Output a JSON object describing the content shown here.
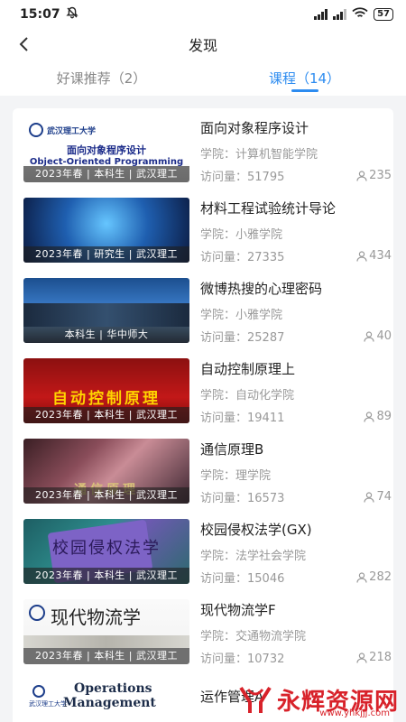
{
  "status": {
    "time": "15:07",
    "net_speed": "5.00\nK/s",
    "battery": "57"
  },
  "nav": {
    "title": "发现"
  },
  "tabs": [
    {
      "label": "好课推荐（2）",
      "active": false
    },
    {
      "label": "课程（14）",
      "active": true
    }
  ],
  "courses": [
    {
      "title": "面向对象程序设计",
      "school": "学院：计算机智能学院",
      "visits": "访问量：51795",
      "learners": "235",
      "caption": "2023年春 | 本科生 | 武汉理工",
      "thumb_title": "面向对象程序设计",
      "thumb_sub": "Object-Oriented Programming",
      "thumb_logo": "武汉理工大学"
    },
    {
      "title": "材料工程试验统计导论",
      "school": "学院：小雅学院",
      "visits": "访问量：27335",
      "learners": "434",
      "caption": "2023年春 | 研究生 | 武汉理工"
    },
    {
      "title": "微博热搜的心理密码",
      "school": "学院：小雅学院",
      "visits": "访问量：25287",
      "learners": "40",
      "caption": "本科生 | 华中师大"
    },
    {
      "title": "自动控制原理上",
      "school": "学院：自动化学院",
      "visits": "访问量：19411",
      "learners": "89",
      "caption": "2023年春 | 本科生 | 武汉理工",
      "thumb_title": "自动控制原理"
    },
    {
      "title": "通信原理B",
      "school": "学院：理学院",
      "visits": "访问量：16573",
      "learners": "74",
      "caption": "2023年春 | 本科生 | 武汉理工",
      "thumb_title": "通信原理"
    },
    {
      "title": "校园侵权法学(GX)",
      "school": "学院：法学社会学院",
      "visits": "访问量：15046",
      "learners": "282",
      "caption": "2023年春 | 本科生 | 武汉理工",
      "thumb_title": "校园侵权法学"
    },
    {
      "title": "现代物流学F",
      "school": "学院：交通物流学院",
      "visits": "访问量：10732",
      "learners": "218",
      "caption": "2023年春 | 本科生 | 武汉理工",
      "thumb_title": "现代物流学",
      "thumb_logo": "武汉理工大学"
    }
  ],
  "partial_course": {
    "thumb_line1": "Operations",
    "thumb_line2": "Management",
    "thumb_logo": "武汉理工大学",
    "title": "运作管理A"
  },
  "watermark": {
    "text": "永辉资源网",
    "url": "www.yhkjjj.com"
  },
  "colors": {
    "accent": "#2d8cf0",
    "watermark": "#d8222a"
  }
}
